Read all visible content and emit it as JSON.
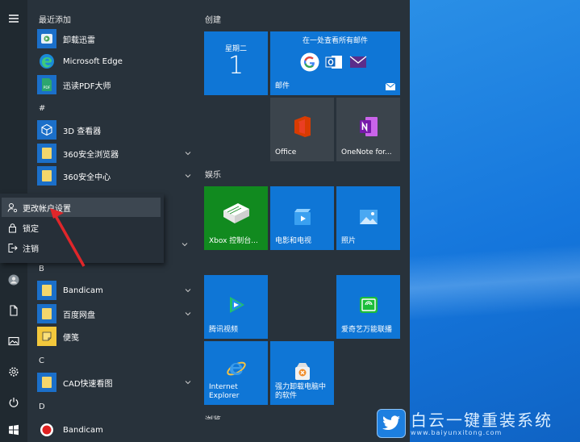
{
  "app_list": {
    "recent_header": "最近添加",
    "recent": [
      {
        "label": "卸载迅雷",
        "icon": "thunder-uninstall-icon"
      },
      {
        "label": "Microsoft Edge",
        "icon": "edge-icon"
      },
      {
        "label": "迅读PDF大师",
        "icon": "pdf-reader-icon"
      }
    ],
    "hash_header": "#",
    "hash_items": [
      {
        "label": "3D 查看器",
        "icon": "3d-viewer-icon"
      },
      {
        "label": "360安全浏览器",
        "icon": "folder-icon"
      },
      {
        "label": "360安全中心",
        "icon": "folder-icon"
      }
    ],
    "b_header": "B",
    "b_items": [
      {
        "label": "Bandicam",
        "icon": "folder-icon"
      },
      {
        "label": "百度网盘",
        "icon": "folder-icon"
      },
      {
        "label": "便笺",
        "icon": "sticky-notes-icon"
      }
    ],
    "c_header": "C",
    "c_items": [
      {
        "label": "CAD快速看图",
        "icon": "folder-icon"
      }
    ],
    "d_header": "D",
    "d_items": [
      {
        "label": "Bandicam",
        "icon": "bandicam-record-icon"
      }
    ]
  },
  "account_flyout": {
    "items": [
      {
        "label": "更改帐户设置",
        "icon": "account-settings-icon",
        "highlighted": true
      },
      {
        "label": "锁定",
        "icon": "lock-icon"
      },
      {
        "label": "注销",
        "icon": "sign-out-icon"
      }
    ]
  },
  "tiles": {
    "group_create": "创建",
    "calendar": {
      "weekday": "星期二",
      "day": "1"
    },
    "mail": {
      "header": "在一处查看所有邮件",
      "label": "邮件"
    },
    "office": {
      "label": "Office"
    },
    "onenote": {
      "label": "OneNote for..."
    },
    "group_entertainment": "娱乐",
    "xbox": {
      "label": "Xbox 控制台..."
    },
    "movies": {
      "label": "电影和电视"
    },
    "photos": {
      "label": "照片"
    },
    "tencent_video": {
      "label": "腾讯视频"
    },
    "iqiyi": {
      "label": "爱奇艺万能联播"
    },
    "ie": {
      "label": "Internet Explorer"
    },
    "uninstaller": {
      "label": "强力卸载电脑中的软件"
    },
    "group_partial": "浏览"
  },
  "watermark": {
    "title": "白云一键重装系统",
    "url": "www.baiyunxitong.com"
  },
  "colors": {
    "tile_blue": "#0f76d6",
    "menu_bg": "#28323b",
    "xbox_green": "#118a1f",
    "arrow_red": "#e0262a"
  }
}
